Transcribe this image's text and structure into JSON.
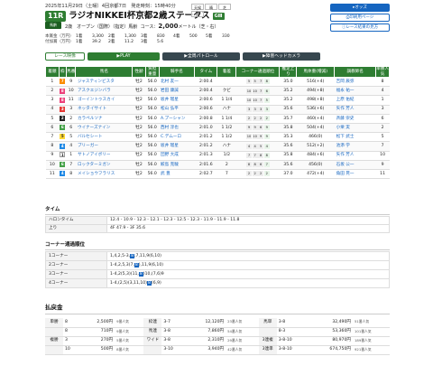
{
  "header": {
    "date_line": "2025年11月29日（土曜）4回京都7日　発走時刻：15時40分",
    "race_number": "11R",
    "race_name": "ラジオNIKKEI杯京都2歳ステークス",
    "grade": "GⅢ",
    "class_badge": "馬齢",
    "conditions": "2歳　オープン（国際）（指定）馬齢",
    "course": "コース：",
    "distance": "2,000",
    "unit": "メートル（芝・右）",
    "weather_labels": [
      "天候",
      "晴",
      "芝",
      "良"
    ],
    "prize_rows": [
      {
        "label": "本賞金（万円）",
        "values": [
          "1着",
          "3,300",
          "2着",
          "1,300",
          "3着",
          "830",
          "4着",
          "500",
          "5着",
          "330"
        ]
      },
      {
        "label": "付加賞（万円）",
        "values": [
          "1着",
          "39.2",
          "2着",
          "11.2",
          "3着",
          "5.6",
          "",
          "",
          "",
          ""
        ]
      }
    ]
  },
  "side_buttons": [
    "オッズ",
    "印刷用ページ",
    "レース結果の見方"
  ],
  "tabs": [
    "レース映像",
    "PLAY",
    "全周パトロール",
    "障害ヘッドカメラ"
  ],
  "results_headers": [
    "着順",
    "枠",
    "馬番",
    "馬名",
    "性齢",
    "負担重量",
    "騎手名",
    "タイム",
    "着差",
    "コーナー通過順位",
    "推定上り",
    "馬体重(増減)",
    "調教師名",
    "単勝人気"
  ],
  "results": [
    {
      "rank": "1",
      "frame": "7",
      "num": "9",
      "horse": "ジャスティンビスタ",
      "sexage": "牡2",
      "wt": "56.0",
      "jockey": "北村 友一",
      "time": "2:00.4",
      "margin": "",
      "corners": [
        "5",
        "5",
        "7",
        "8"
      ],
      "last": "35.0",
      "bw": "516(+4)",
      "trainer": "吉岡 辰弥",
      "pop": "8"
    },
    {
      "rank": "2",
      "frame": "8",
      "num": "10",
      "horse": "アスクエジンバラ",
      "sexage": "牡2",
      "wt": "56.0",
      "jockey": "岩田 康誠",
      "time": "2:00.4",
      "margin": "クビ",
      "corners": [
        "10",
        "10",
        "7",
        "6"
      ],
      "last": "35.2",
      "bw": "494(+8)",
      "trainer": "福永 祐一",
      "pop": "4"
    },
    {
      "rank": "3",
      "frame": "8",
      "num": "11",
      "horse": "ゴーイントゥスカイ",
      "sexage": "牡2",
      "wt": "56.0",
      "jockey": "坂井 瑠星",
      "time": "2:00.6",
      "merge": "",
      "margin": "1 1/4",
      "corners": [
        "10",
        "10",
        "7",
        "5"
      ],
      "last": "35.2",
      "bw": "498(+8)",
      "trainer": "上原 佑紀",
      "pop": "1"
    },
    {
      "rank": "4",
      "frame": "3",
      "num": "3",
      "horse": "ネッタイサイト",
      "sexage": "牡2",
      "wt": "56.0",
      "jockey": "松山 弘平",
      "time": "2:00.6",
      "margin": "ハナ",
      "corners": [
        "3",
        "3",
        "3",
        "3"
      ],
      "last": "35.6",
      "bw": "536(+6)",
      "trainer": "矢作 芳人",
      "pop": "3"
    },
    {
      "rank": "5",
      "frame": "2",
      "num": "2",
      "horse": "カラペルソナ",
      "sexage": "牡2",
      "wt": "56.0",
      "jockey": "A.プーシャン",
      "time": "2:00.8",
      "margin": "1 1/4",
      "corners": [
        "2",
        "2",
        "2",
        "2"
      ],
      "last": "35.7",
      "bw": "460(+4)",
      "trainer": "斉藤 崇史",
      "pop": "6"
    },
    {
      "rank": "6",
      "frame": "6",
      "num": "6",
      "horse": "ウイナーズナイン",
      "sexage": "牡2",
      "wt": "56.0",
      "jockey": "西村 淳也",
      "time": "2:01.0",
      "margin": "1 1/2",
      "corners": [
        "9",
        "9",
        "6",
        "9"
      ],
      "last": "35.8",
      "bw": "504(+4)",
      "trainer": "小栗 実",
      "pop": "2"
    },
    {
      "rank": "7",
      "frame": "5",
      "num": "5",
      "horse": "バルセシート",
      "sexage": "牡2",
      "wt": "56.0",
      "jockey": "C.デムーロ",
      "time": "2:01.2",
      "margin": "1 1/2",
      "corners": [
        "10",
        "10",
        "9",
        "9"
      ],
      "last": "35.3",
      "bw": "466(0)",
      "trainer": "松下 武士",
      "pop": "5"
    },
    {
      "rank": "8",
      "frame": "4",
      "num": "4",
      "horse": "ブリーガー",
      "sexage": "牡2",
      "wt": "56.0",
      "jockey": "坂井 瑠星",
      "time": "2:01.2",
      "margin": "ハナ",
      "corners": [
        "4",
        "4",
        "5",
        "4"
      ],
      "last": "35.6",
      "bw": "512(+2)",
      "trainer": "池添 学",
      "pop": "7"
    },
    {
      "rank": "9",
      "frame": "1",
      "num": "1",
      "horse": "サトノアイボリー",
      "sexage": "牡2",
      "wt": "56.0",
      "jockey": "団野 大成",
      "time": "2:01.3",
      "margin": "1/2",
      "corners": [
        "7",
        "7",
        "8",
        "8"
      ],
      "last": "35.8",
      "bw": "484(+6)",
      "trainer": "矢作 芳人",
      "pop": "10"
    },
    {
      "rank": "10",
      "frame": "6",
      "num": "7",
      "horse": "ロックターミガン",
      "sexage": "牡2",
      "wt": "56.0",
      "jockey": "鮫島 克駿",
      "time": "2:01.6",
      "margin": "2",
      "corners": [
        "8",
        "8",
        "6",
        "7"
      ],
      "last": "35.6",
      "bw": "456(0)",
      "trainer": "石坂 公一",
      "pop": "9"
    },
    {
      "rank": "11",
      "frame": "4",
      "num": "8",
      "horse": "メイショウフラリス",
      "sexage": "牡2",
      "wt": "56.0",
      "jockey": "武 豊",
      "time": "2:02.7",
      "margin": "7",
      "corners": [
        "2",
        "2",
        "2",
        "2"
      ],
      "last": "37.0",
      "bw": "472(+4)",
      "trainer": "角田 晃一",
      "pop": "11"
    }
  ],
  "frame_colors": {
    "1": "#ffffff",
    "2": "#222222",
    "3": "#e53935",
    "4": "#1e88e5",
    "5": "#fdd835",
    "6": "#43a047",
    "7": "#fb8c00",
    "8": "#ec407a"
  },
  "time_section": {
    "title": "タイム",
    "rows": [
      {
        "k": "ハロンタイム",
        "v": "12.4 - 10.9 - 12.3 - 12.1 - 12.3 - 12.5 - 12.3 - 11.9 - 11.9 - 11.8"
      },
      {
        "k": "上り",
        "v": "4F 47.9 - 3F 35.6"
      }
    ]
  },
  "corner_section": {
    "title": "コーナー通過順位",
    "rows": [
      {
        "k": "1コーナー",
        "pre": "1,4,2,5-3,",
        "hl": "8",
        "post": ",7,11,9(6,10)"
      },
      {
        "k": "2コーナー",
        "pre": "1-4,2,5,3(7,",
        "hl": "8",
        "post": "),11,9(6,10)"
      },
      {
        "k": "3コーナー",
        "pre": "1-4,2(5,3)(11,",
        "hl": "8",
        "post": ")10,(7,6)9"
      },
      {
        "k": "4コーナー",
        "pre": "1-4,(2,5)(3,11,10)",
        "hl": "8",
        "post": "(6,9)"
      }
    ]
  },
  "payout_title": "払戻金",
  "payout": [
    {
      "a": "単勝",
      "b": "8",
      "c": "2,500円",
      "d": "9番人気",
      "e": "枠連",
      "f": "3-7",
      "g": "12,120円",
      "h": "23番人気",
      "i": "馬単",
      "j": "3-8",
      "k": "32,490円",
      "l": "51番人気"
    },
    {
      "a": "",
      "b": "8",
      "c": "710円",
      "d": "9番人気",
      "e": "馬連",
      "f": "3-8",
      "g": "7,860円",
      "h": "54番人気",
      "i": "",
      "j": "8-3",
      "k": "53,360円",
      "l": "101番人気"
    },
    {
      "a": "複勝",
      "b": "3",
      "c": "270円",
      "d": "5番人気",
      "e": "ワイド",
      "f": "3-8",
      "g": "2,310円",
      "h": "29番人気",
      "i": "3連複",
      "j": "3-8-10",
      "k": "80,970円",
      "l": "189番人気"
    },
    {
      "a": "",
      "b": "10",
      "c": "500円",
      "d": "8番人気",
      "e": "",
      "f": "3-10",
      "g": "3,940円",
      "h": "42番人気",
      "i": "3連単",
      "j": "3-8-10",
      "k": "674,750円",
      "l": "921番人気"
    }
  ]
}
